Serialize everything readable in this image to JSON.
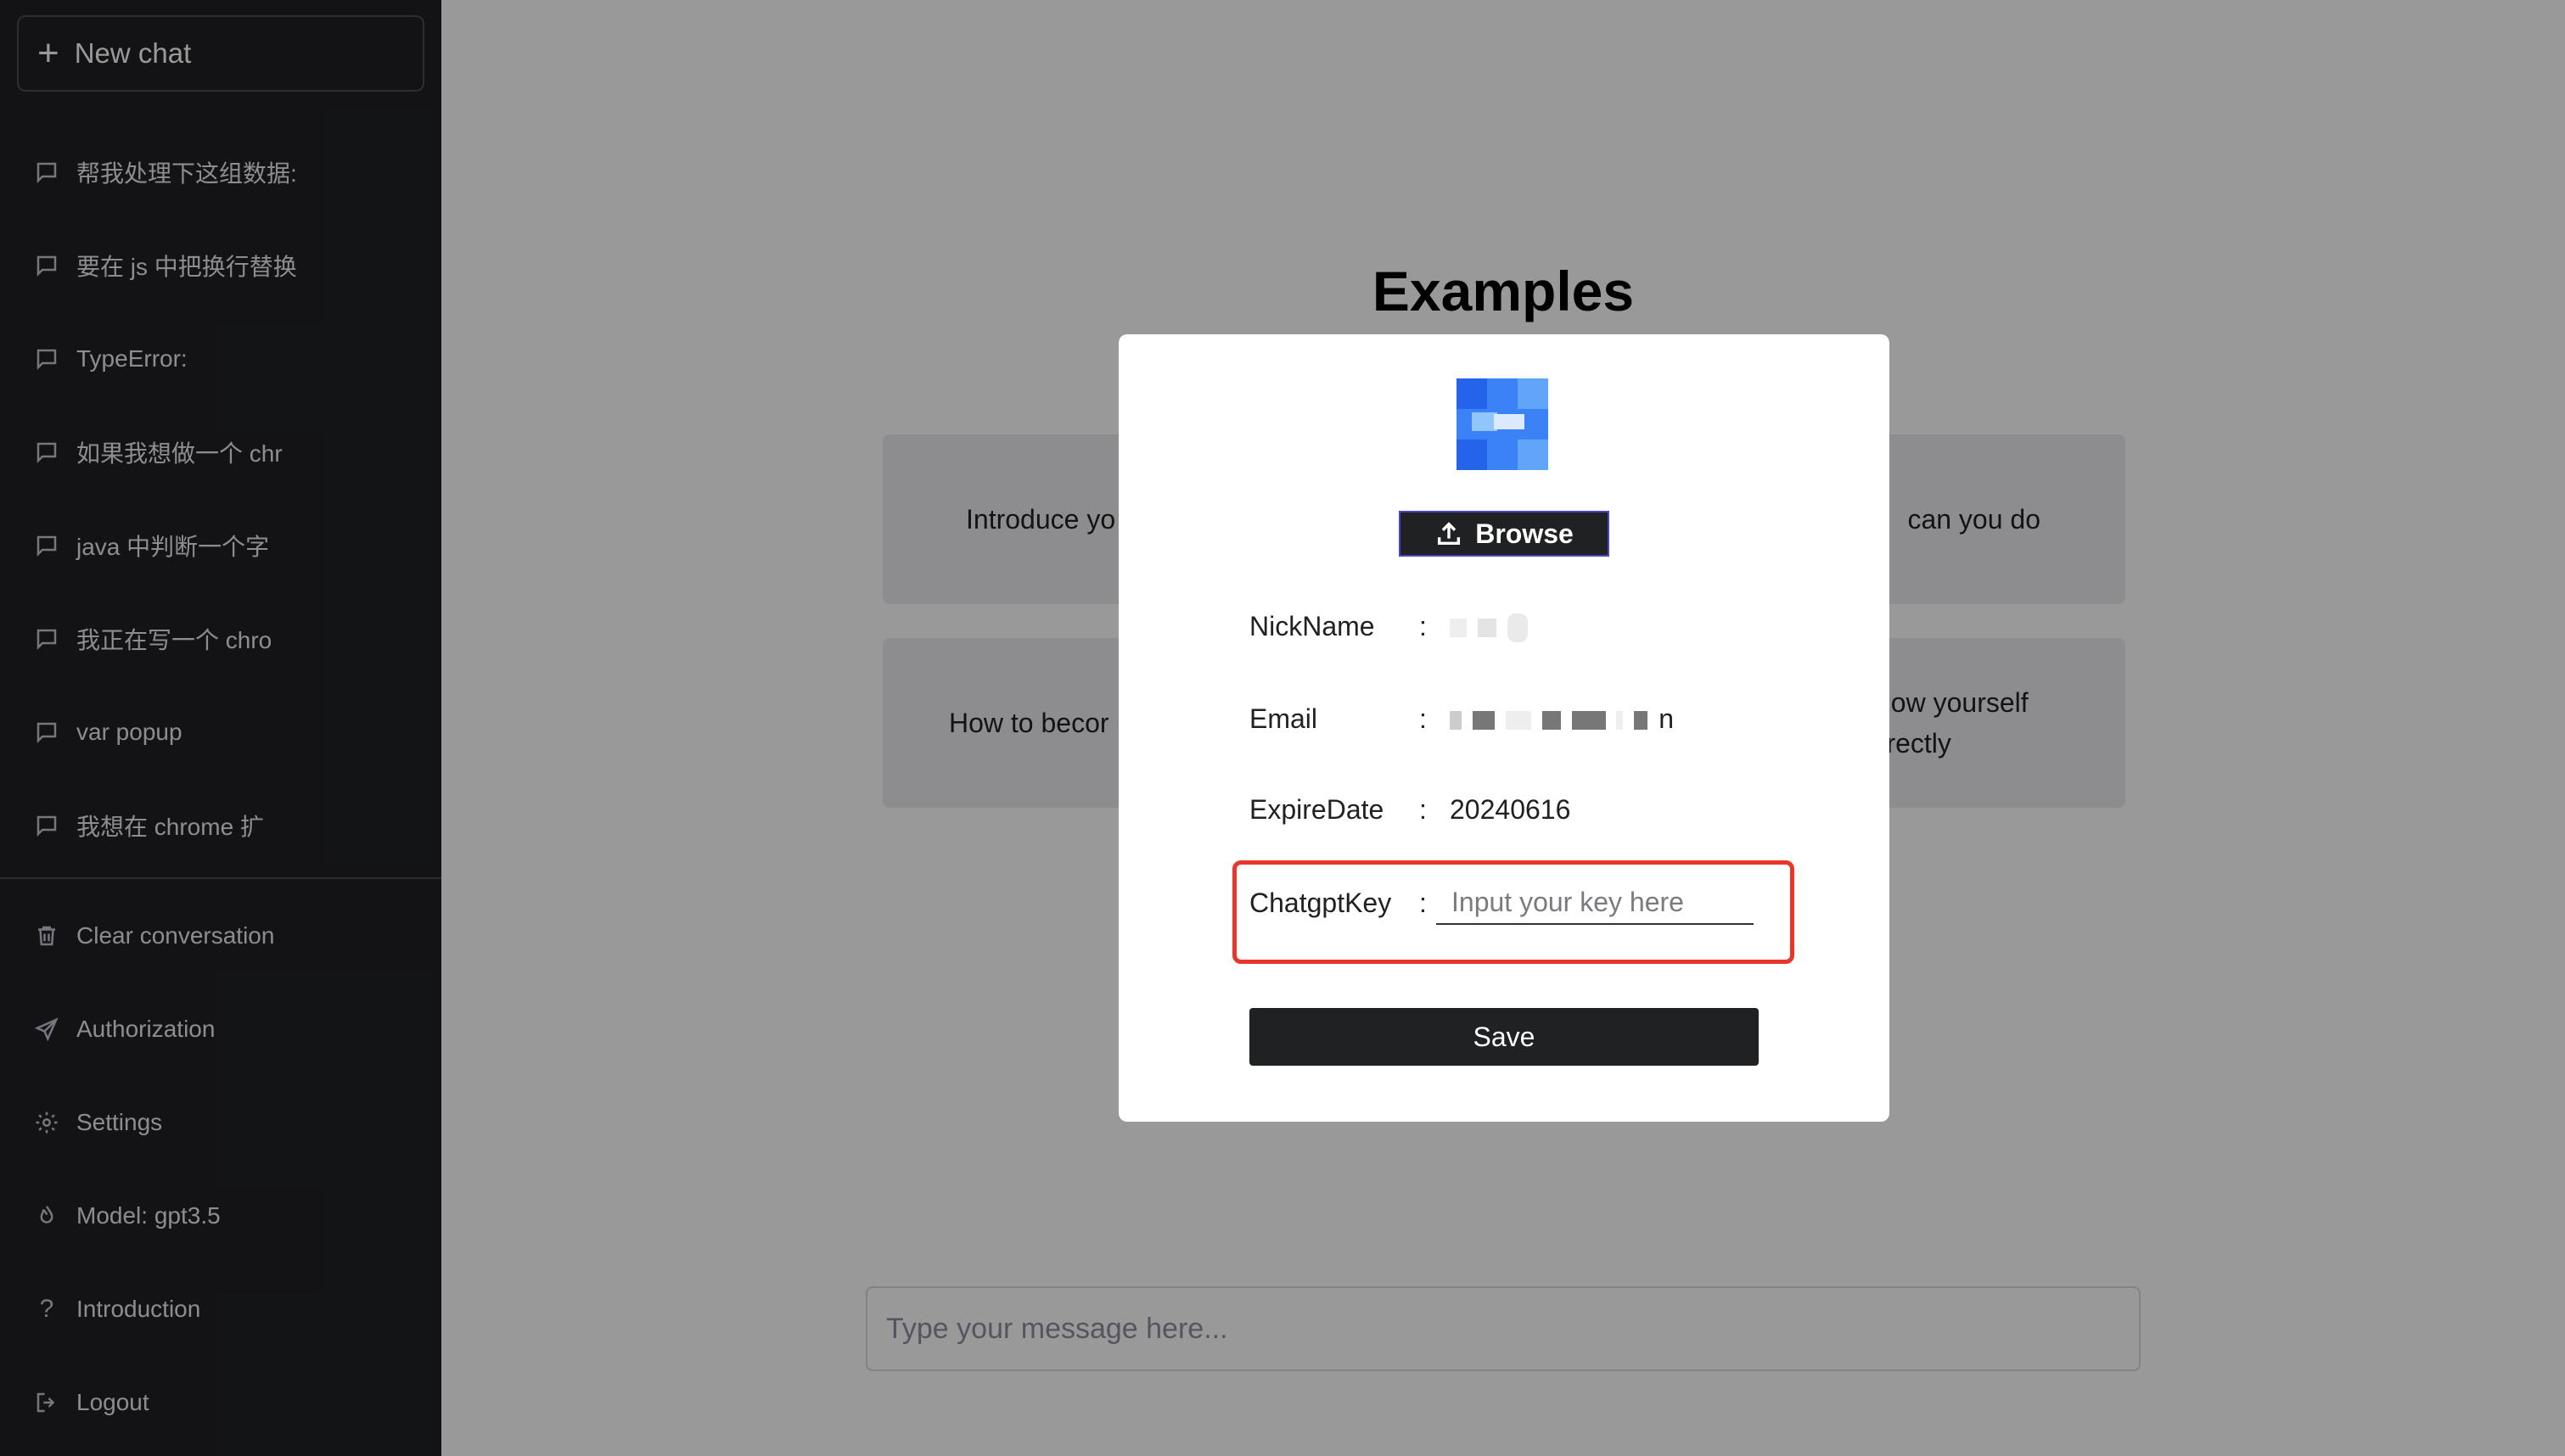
{
  "sidebar": {
    "new_chat_label": "New chat",
    "history": [
      {
        "label": "帮我处理下这组数据:"
      },
      {
        "label": "要在 js 中把换行替换"
      },
      {
        "label": "TypeError:"
      },
      {
        "label": "如果我想做一个 chr"
      },
      {
        "label": "java 中判断一个字"
      },
      {
        "label": "我正在写一个 chro"
      },
      {
        "label": "var popup"
      },
      {
        "label": "我想在 chrome 扩"
      }
    ],
    "menu": {
      "clear": "Clear conversation",
      "authorization": "Authorization",
      "settings": "Settings",
      "model": "Model: gpt3.5",
      "introduction": "Introduction",
      "logout": "Logout"
    }
  },
  "main": {
    "examples_title": "Examples",
    "cards": [
      {
        "text": "Introduce yo"
      },
      {
        "text": "can you do"
      },
      {
        "text": "How to becor"
      },
      {
        "text": "know yourself orrectly"
      }
    ],
    "message_placeholder": "Type your message here..."
  },
  "modal": {
    "browse_label": "Browse",
    "fields": {
      "nickname_label": "NickName",
      "email_label": "Email",
      "email_suffix": "n",
      "expire_label": "ExpireDate",
      "expire_value": "20240616",
      "key_label": "ChatgptKey",
      "key_placeholder": "Input your key here",
      "colon": ":"
    },
    "save_label": "Save"
  },
  "colors": {
    "sidebar_bg": "#202123",
    "highlight": "#e8362b",
    "avatar_blue": "#3b82f6"
  }
}
